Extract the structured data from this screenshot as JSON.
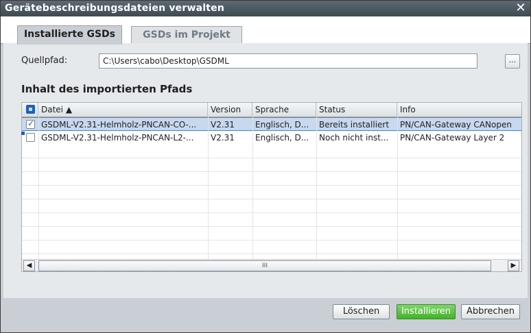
{
  "window": {
    "title": "Gerätebeschreibungsdateien verwalten"
  },
  "tabs": [
    {
      "label": "Installierte GSDs"
    },
    {
      "label": "GSDs im Projekt"
    }
  ],
  "source": {
    "label": "Quellpfad:",
    "value": "C:\\Users\\cabo\\Desktop\\GSDML",
    "browse_label": "..."
  },
  "section": {
    "title": "Inhalt des importierten Pfads"
  },
  "table": {
    "columns": [
      {
        "label": "Datei ▲"
      },
      {
        "label": "Version"
      },
      {
        "label": "Sprache"
      },
      {
        "label": "Status"
      },
      {
        "label": "Info"
      }
    ],
    "rows": [
      {
        "checked": true,
        "selected": true,
        "file": "GSDML-V2.31-Helmholz-PNCAN-CO-...",
        "version": "V2.31",
        "language": "Englisch, D...",
        "status": "Bereits installiert",
        "info": "PN/CAN-Gateway CANopen"
      },
      {
        "checked": false,
        "selected": false,
        "file": "GSDML-V2.31-Helmholz-PNCAN-L2-...",
        "version": "V2.31",
        "language": "Englisch, D...",
        "status": "Noch nicht inst...",
        "info": "PN/CAN-Gateway Layer 2"
      }
    ]
  },
  "scrollbar": {
    "thumb_grip": "III"
  },
  "buttons": {
    "delete": "Löschen",
    "install": "Installieren",
    "cancel": "Abbrechen"
  },
  "colors": {
    "titlebar": "#4a555d",
    "install_button": "#54b83b",
    "selection": "#c8d8ee"
  }
}
